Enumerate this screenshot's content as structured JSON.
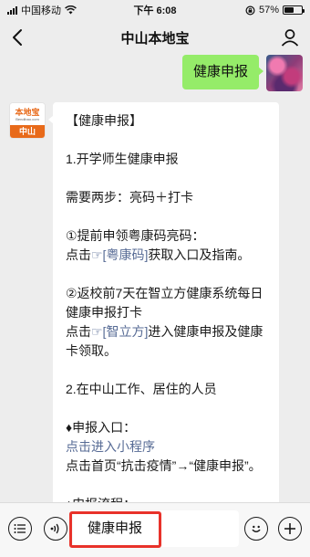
{
  "status_bar": {
    "carrier": "中国移动",
    "time": "下午 6:08",
    "battery_percent": "57%",
    "battery_level": 0.57
  },
  "nav": {
    "title": "中山本地宝"
  },
  "sent_message": {
    "text": "健康申报"
  },
  "account_avatar": {
    "brand": "本地宝",
    "domain": "Bendibao.com",
    "city": "中山"
  },
  "received_message": {
    "title": "【健康申报】",
    "section1_heading": "1.开学师生健康申报",
    "steps_intro": "需要两步：亮码＋打卡",
    "step1_line": "①提前申领粤康码亮码：",
    "step1_prefix": "点击",
    "step1_link": "☞[粤康码]",
    "step1_suffix": "获取入口及指南。",
    "step2_line": "②返校前7天在智立方健康系统每日健康申报打卡",
    "step2_prefix": "点击",
    "step2_link": "☞[智立方]",
    "step2_suffix": "进入健康申报及健康卡领取。",
    "section2_heading": "2.在中山工作、居住的人员",
    "entry_label": "♦申报入口：",
    "entry_link": "点击进入小程序",
    "entry_text": "点击首页“抗击疫情”→“健康申报”。",
    "process_label": "♦申报流程："
  },
  "input_bar": {
    "value": "健康申报"
  },
  "colors": {
    "sent_bubble": "#95ec69",
    "link": "#576b95",
    "highlight": "#e8322a",
    "brand_orange": "#e86a1a"
  }
}
